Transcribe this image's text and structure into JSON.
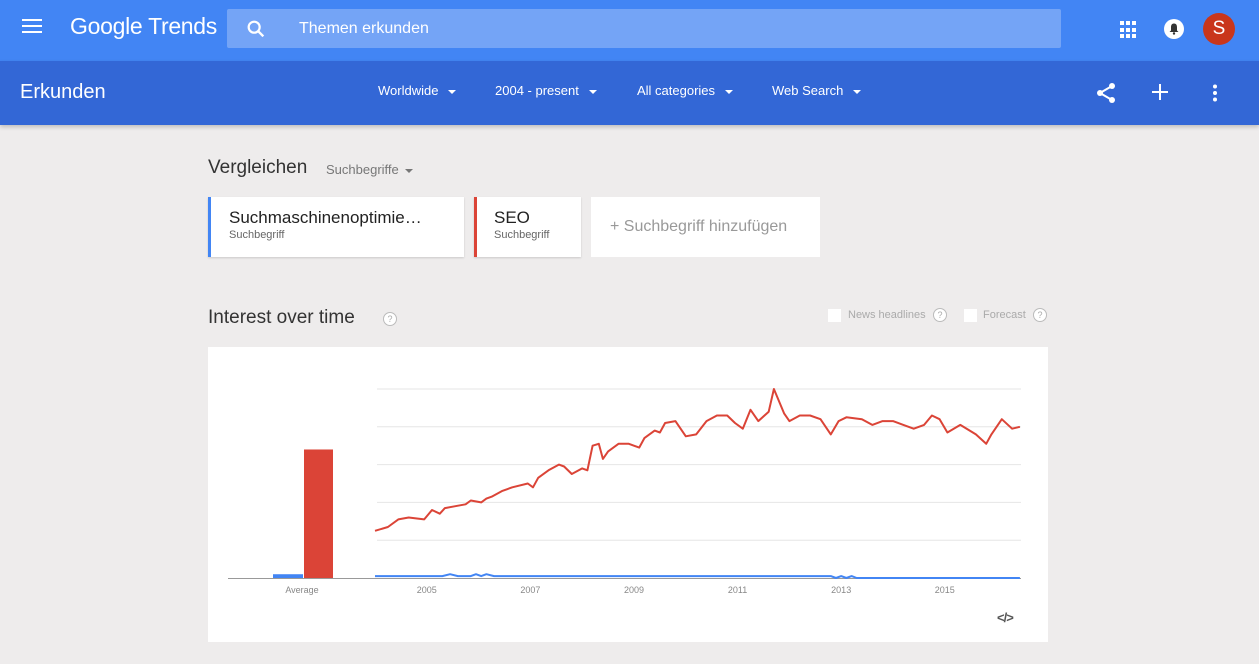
{
  "topbar": {
    "logo_google": "Google",
    "logo_trends": "Trends",
    "search_placeholder": "Themen erkunden",
    "avatar_initial": "S",
    "color": "#4285f4"
  },
  "subbar": {
    "title": "Erkunden",
    "filters": [
      {
        "label": "Worldwide"
      },
      {
        "label": "2004 - present"
      },
      {
        "label": "All categories"
      },
      {
        "label": "Web Search"
      }
    ],
    "color": "#3367d6"
  },
  "compare": {
    "title": "Vergleichen",
    "type_label": "Suchbegriffe",
    "terms": [
      {
        "name": "Suchmaschinenoptimie…",
        "sub": "Suchbegriff",
        "color": "#4285f4"
      },
      {
        "name": "SEO",
        "sub": "Suchbegriff",
        "color": "#db4437"
      }
    ],
    "add_label": "+ Suchbegriff hinzufügen"
  },
  "interest": {
    "title": "Interest over time",
    "help": "?",
    "news_headlines_label": "News headlines",
    "forecast_label": "Forecast",
    "embed_label": "</>"
  },
  "chart_data": {
    "type": "line",
    "title": "Interest over time",
    "xlabel": "",
    "ylabel": "",
    "ylim": [
      0,
      100
    ],
    "x_range": [
      "2004-01",
      "2016-06"
    ],
    "x_ticks": [
      "2005",
      "2007",
      "2009",
      "2011",
      "2013",
      "2015"
    ],
    "grid": true,
    "average": {
      "label": "Average",
      "values": [
        {
          "name": "Suchmaschinenoptimierung",
          "value": 2,
          "color": "#4285f4"
        },
        {
          "name": "SEO",
          "value": 68,
          "color": "#db4437"
        }
      ]
    },
    "series": [
      {
        "name": "Suchmaschinenoptimierung",
        "color": "#4285f4",
        "x_year": [
          2004.0,
          2005.3,
          2005.45,
          2005.6,
          2005.85,
          2005.95,
          2006.05,
          2006.15,
          2006.3,
          2012.8,
          2012.9,
          2013.0,
          2013.1,
          2013.2,
          2013.3,
          2016.45
        ],
        "values": [
          1,
          1,
          2,
          1,
          1,
          2,
          1,
          2,
          1,
          1,
          0,
          1,
          0,
          1,
          0,
          0
        ]
      },
      {
        "name": "SEO",
        "color": "#db4437",
        "x_year": [
          2004.0,
          2004.25,
          2004.45,
          2004.65,
          2004.95,
          2005.1,
          2005.25,
          2005.35,
          2005.55,
          2005.75,
          2005.85,
          2006.05,
          2006.15,
          2006.25,
          2006.45,
          2006.65,
          2006.95,
          2007.05,
          2007.15,
          2007.35,
          2007.55,
          2007.65,
          2007.8,
          2008.0,
          2008.1,
          2008.2,
          2008.32,
          2008.4,
          2008.5,
          2008.7,
          2008.9,
          2009.1,
          2009.2,
          2009.4,
          2009.5,
          2009.6,
          2009.8,
          2010.0,
          2010.2,
          2010.4,
          2010.6,
          2010.8,
          2010.95,
          2011.1,
          2011.25,
          2011.4,
          2011.6,
          2011.7,
          2011.9,
          2012.0,
          2012.2,
          2012.4,
          2012.6,
          2012.8,
          2012.95,
          2013.1,
          2013.4,
          2013.6,
          2013.8,
          2014.0,
          2014.2,
          2014.4,
          2014.6,
          2014.75,
          2014.9,
          2015.05,
          2015.3,
          2015.6,
          2015.8,
          2015.9,
          2016.1,
          2016.3,
          2016.45
        ],
        "values": [
          25,
          27,
          31,
          32,
          31,
          36,
          34,
          37,
          38,
          39,
          41,
          40,
          42,
          43,
          46,
          48,
          50,
          48,
          53,
          57,
          60,
          59,
          55,
          58,
          57,
          70,
          71,
          63,
          67,
          71,
          71,
          69,
          74,
          78,
          77,
          82,
          83,
          75,
          76,
          83,
          86,
          86,
          82,
          79,
          89,
          83,
          88,
          100,
          87,
          83,
          86,
          86,
          84,
          76,
          83,
          85,
          84,
          81,
          83,
          83,
          81,
          79,
          81,
          86,
          84,
          77,
          81,
          76,
          71,
          76,
          84,
          79,
          80
        ]
      }
    ]
  }
}
